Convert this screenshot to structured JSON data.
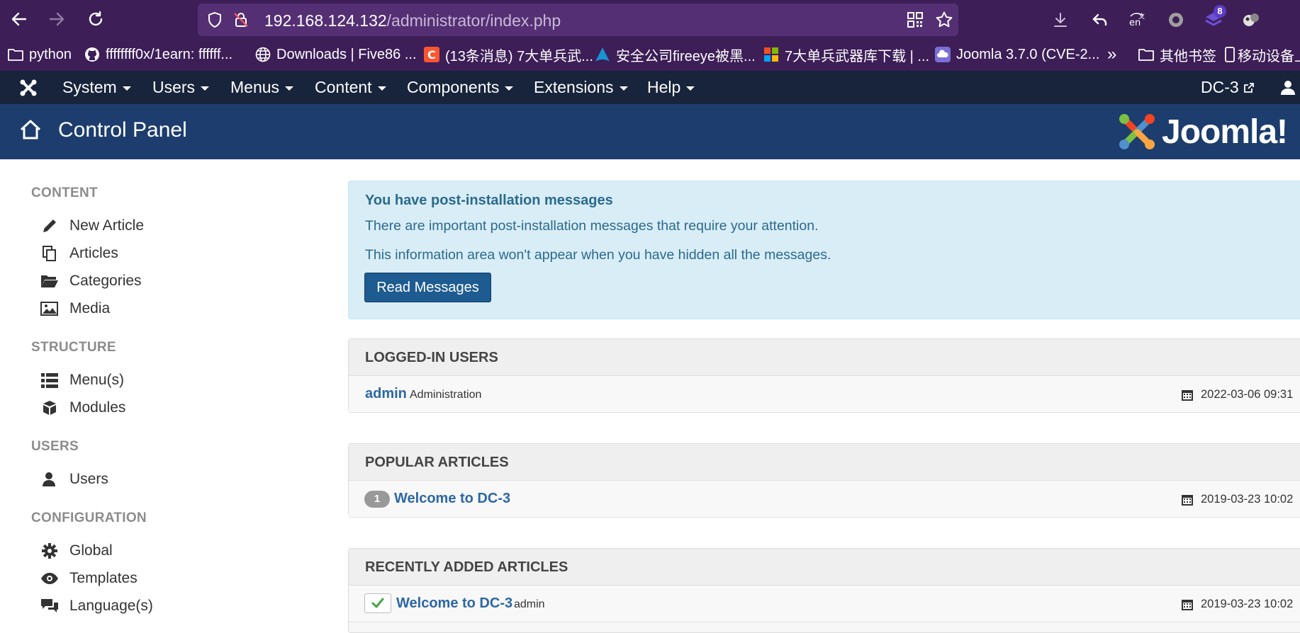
{
  "browser": {
    "url_host": "192.168.124.132",
    "url_path": "/administrator/index.php",
    "extension_badge": "8",
    "bookmarks": [
      {
        "label": "python",
        "icon": "folder-icon"
      },
      {
        "label": "ffffffff0x/1earn: ffffff...",
        "icon": "github-icon"
      },
      {
        "label": "Downloads | Five86 ...",
        "icon": "globe-icon"
      },
      {
        "label": "(13条消息) 7大单兵武...",
        "icon": "csdn-icon"
      },
      {
        "label": "安全公司fireeye被黑...",
        "icon": "arch-icon"
      },
      {
        "label": "7大单兵武器库下载 | ...",
        "icon": "windows-tiles-icon"
      },
      {
        "label": "Joomla 3.7.0 (CVE-2...",
        "icon": "cloud-icon"
      }
    ],
    "bookmarks_overflow": "»",
    "other_bookmarks": "其他书签",
    "mobile_bookmarks": "移动设备上"
  },
  "admin_nav": {
    "menus": [
      "System",
      "Users",
      "Menus",
      "Content",
      "Components",
      "Extensions",
      "Help"
    ],
    "site_link": "DC-3"
  },
  "header": {
    "title": "Control Panel",
    "logo_text": "Joomla!"
  },
  "sidebar": {
    "sections": [
      {
        "heading": "CONTENT",
        "items": [
          {
            "label": "New Article",
            "icon": "pencil-icon"
          },
          {
            "label": "Articles",
            "icon": "copy-icon"
          },
          {
            "label": "Categories",
            "icon": "folder-open-icon"
          },
          {
            "label": "Media",
            "icon": "image-icon"
          }
        ]
      },
      {
        "heading": "STRUCTURE",
        "items": [
          {
            "label": "Menu(s)",
            "icon": "list-icon"
          },
          {
            "label": "Modules",
            "icon": "cube-icon"
          }
        ]
      },
      {
        "heading": "USERS",
        "items": [
          {
            "label": "Users",
            "icon": "user-icon"
          }
        ]
      },
      {
        "heading": "CONFIGURATION",
        "items": [
          {
            "label": "Global",
            "icon": "gear-icon"
          },
          {
            "label": "Templates",
            "icon": "eye-icon"
          },
          {
            "label": "Language(s)",
            "icon": "comments-icon"
          }
        ]
      }
    ]
  },
  "alert": {
    "heading": "You have post-installation messages",
    "line1": "There are important post-installation messages that require your attention.",
    "line2": "This information area won't appear when you have hidden all the messages.",
    "button": "Read Messages"
  },
  "panels": {
    "logged_in": {
      "title": "LOGGED-IN USERS",
      "rows": [
        {
          "user": "admin",
          "client": "Administration",
          "date": "2022-03-06 09:31"
        }
      ]
    },
    "popular": {
      "title": "POPULAR ARTICLES",
      "rows": [
        {
          "hits": "1",
          "title": "Welcome to DC-3",
          "date": "2019-03-23 10:02"
        }
      ]
    },
    "recent": {
      "title": "RECENTLY ADDED ARTICLES",
      "rows": [
        {
          "title": "Welcome to DC-3",
          "author": "admin",
          "date": "2019-03-23 10:02"
        }
      ]
    }
  },
  "colors": {
    "browser_chrome": "#3d1e57",
    "admin_nav": "#17243b",
    "header": "#1c3d6d",
    "link": "#2c67a3",
    "alert_bg": "#d9edf7"
  }
}
